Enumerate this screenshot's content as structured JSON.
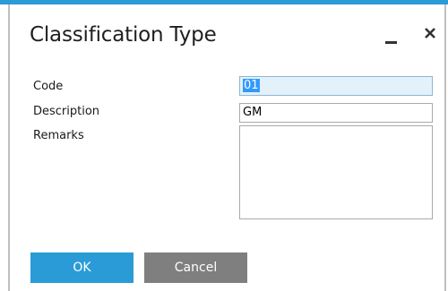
{
  "dialog": {
    "title": "Classification Type"
  },
  "fields": {
    "code": {
      "label": "Code",
      "value": "01"
    },
    "description": {
      "label": "Description",
      "value": "GM"
    },
    "remarks": {
      "label": "Remarks",
      "value": ""
    }
  },
  "buttons": {
    "ok_label": "OK",
    "cancel_label": "Cancel"
  },
  "icons": {
    "minimize": "minimize-icon",
    "close": "close-icon"
  },
  "colors": {
    "accent": "#2a9bd6",
    "cancel": "#7f7f7f",
    "selection": "#3399ff",
    "active_field": "#e3f1fb"
  }
}
